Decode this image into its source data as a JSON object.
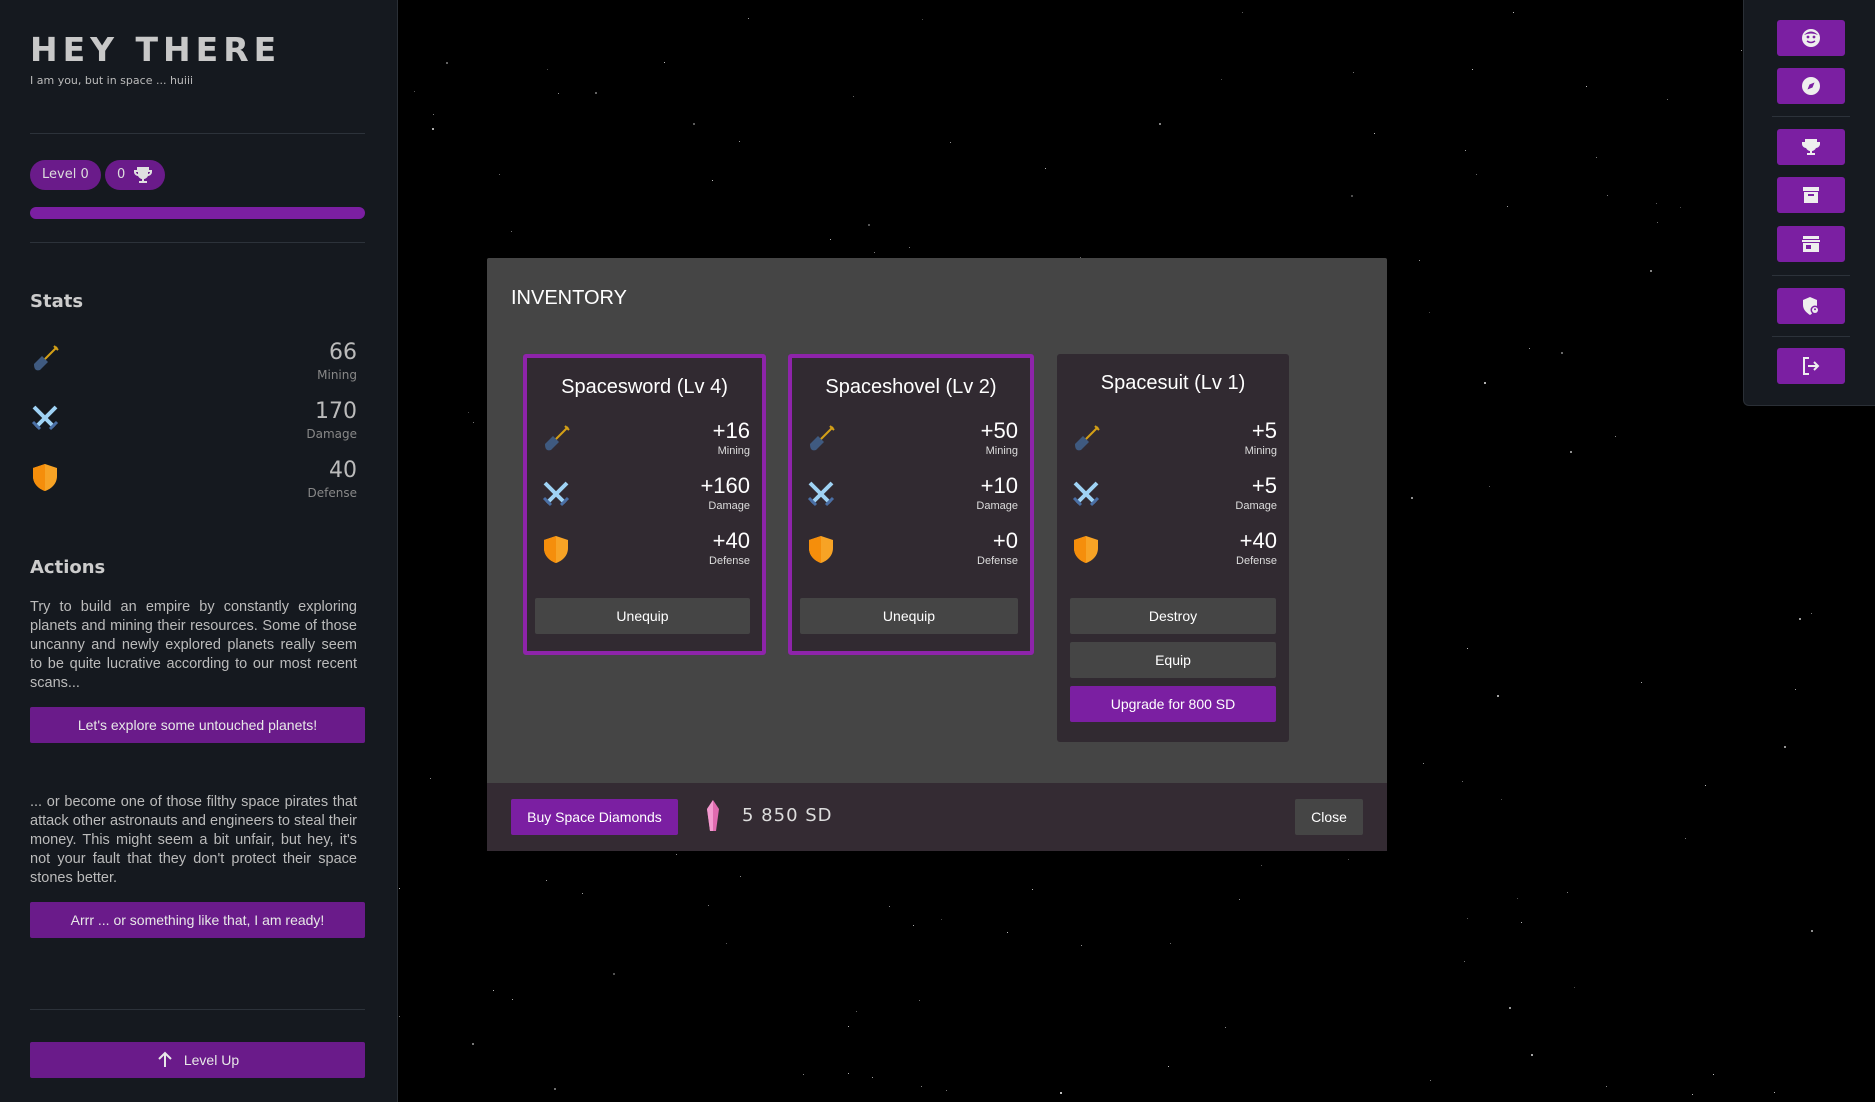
{
  "sidebar": {
    "title": "HEY THERE",
    "subtitle": "I am you, but in space ... huiii",
    "level_label": "Level 0",
    "trophies": "0",
    "stats_title": "Stats",
    "stats": [
      {
        "icon": "shovel-icon",
        "value": "66",
        "label": "Mining"
      },
      {
        "icon": "swords-icon",
        "value": "170",
        "label": "Damage"
      },
      {
        "icon": "shield-icon",
        "value": "40",
        "label": "Defense"
      }
    ],
    "actions_title": "Actions",
    "explore_text": "Try to build an empire by constantly exploring planets and mining their resources. Some of those uncanny and newly explored planets really seem to be quite lucrative according to our most recent scans...",
    "explore_button": "Let's explore some untouched planets!",
    "pirate_text": "... or become one of those filthy space pirates that attack other astronauts and engineers to steal their money. This might seem a bit unfair, but hey, it's not your fault that they don't protect their space stones better.",
    "pirate_button": "Arrr ... or something like that, I am ready!",
    "levelup_button": "Level Up"
  },
  "rightnav": {
    "items": [
      "avatar-icon",
      "compass-icon",
      "trophy-icon",
      "archive-icon",
      "store-icon",
      "security-icon",
      "logout-icon"
    ]
  },
  "inventory": {
    "title": "INVENTORY",
    "items": [
      {
        "name": "Spacesword (Lv 4)",
        "equipped": true,
        "mining": "+16",
        "damage": "+160",
        "defense": "+40",
        "mining_label": "Mining",
        "damage_label": "Damage",
        "defense_label": "Defense",
        "unequip": "Unequip"
      },
      {
        "name": "Spaceshovel (Lv 2)",
        "equipped": true,
        "mining": "+50",
        "damage": "+10",
        "defense": "+0",
        "mining_label": "Mining",
        "damage_label": "Damage",
        "defense_label": "Defense",
        "unequip": "Unequip"
      },
      {
        "name": "Spacesuit (Lv 1)",
        "equipped": false,
        "mining": "+5",
        "damage": "+5",
        "defense": "+40",
        "mining_label": "Mining",
        "damage_label": "Damage",
        "defense_label": "Defense",
        "destroy": "Destroy",
        "equip": "Equip",
        "upgrade": "Upgrade for 800 SD"
      }
    ],
    "buy_button": "Buy Space Diamonds",
    "balance": "5 850 SD",
    "close_button": "Close"
  },
  "colors": {
    "accent": "#7b1fa2",
    "modal_bg": "#454545",
    "card_bg": "#312a31",
    "sidebar_bg": "#15191f"
  }
}
